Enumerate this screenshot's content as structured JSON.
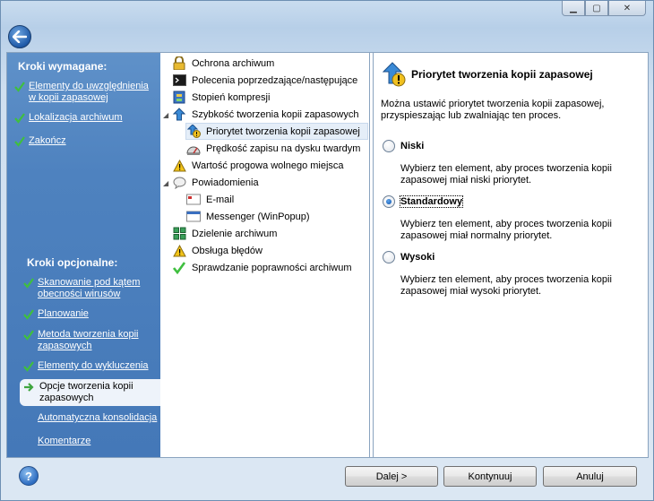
{
  "titlebar": {
    "minimize_icon": "minimize-icon",
    "maximize_icon": "maximize-icon",
    "close_icon": "close-icon"
  },
  "left": {
    "required_header": "Kroki wymagane:",
    "required_items": [
      {
        "label": "Elementy do uwzględnienia w kopii zapasowej"
      },
      {
        "label": "Lokalizacja archiwum"
      },
      {
        "label": "Zakończ"
      }
    ],
    "optional_header": "Kroki opcjonalne:",
    "optional_items": [
      {
        "label": "Skanowanie pod kątem obecności wirusów"
      },
      {
        "label": "Planowanie"
      },
      {
        "label": "Metoda tworzenia kopii zapasowych"
      },
      {
        "label": "Elementy do wykluczenia"
      },
      {
        "label": "Opcje tworzenia kopii zapasowych"
      },
      {
        "label": "Automatyczna konsolidacja"
      },
      {
        "label": "Komentarze"
      }
    ]
  },
  "tree": {
    "items": [
      {
        "label": "Ochrona archiwum",
        "icon": "lock-icon"
      },
      {
        "label": "Polecenia poprzedzające/następujące",
        "icon": "console-icon"
      },
      {
        "label": "Stopień kompresji",
        "icon": "compression-icon"
      },
      {
        "label": "Szybkość tworzenia kopii zapasowych",
        "icon": "speed-icon"
      },
      {
        "label": "Priorytet tworzenia kopii zapasowej",
        "icon": "priority-icon"
      },
      {
        "label": "Prędkość zapisu na dysku twardym",
        "icon": "disk-speed-icon"
      },
      {
        "label": "Wartość progowa wolnego miejsca",
        "icon": "warning-icon"
      },
      {
        "label": "Powiadomienia",
        "icon": "notification-icon"
      },
      {
        "label": "E-mail",
        "icon": "email-icon"
      },
      {
        "label": "Messenger (WinPopup)",
        "icon": "messenger-icon"
      },
      {
        "label": "Dzielenie archiwum",
        "icon": "split-icon"
      },
      {
        "label": "Obsługa błędów",
        "icon": "error-warning-icon"
      },
      {
        "label": "Sprawdzanie poprawności archiwum",
        "icon": "validate-icon"
      }
    ]
  },
  "right": {
    "title": "Priorytet tworzenia kopii zapasowej",
    "description": "Można ustawić priorytet tworzenia kopii zapasowej, przyspieszając lub zwalniając ten proces.",
    "options": [
      {
        "label": "Niski",
        "description": "Wybierz ten element, aby proces tworzenia kopii zapasowej miał niski priorytet.",
        "checked": false
      },
      {
        "label": "Standardowy",
        "description": "Wybierz ten element, aby proces tworzenia kopii zapasowej miał normalny priorytet.",
        "checked": true
      },
      {
        "label": "Wysoki",
        "description": "Wybierz ten element, aby proces tworzenia kopii zapasowej miał wysoki priorytet.",
        "checked": false
      }
    ]
  },
  "footer": {
    "help_label": "?",
    "next_label": "Dalej >",
    "continue_label": "Kontynuuj",
    "cancel_label": "Anuluj"
  },
  "colors": {
    "left_panel": "#4e82bf",
    "accent": "#1f5aa8"
  }
}
